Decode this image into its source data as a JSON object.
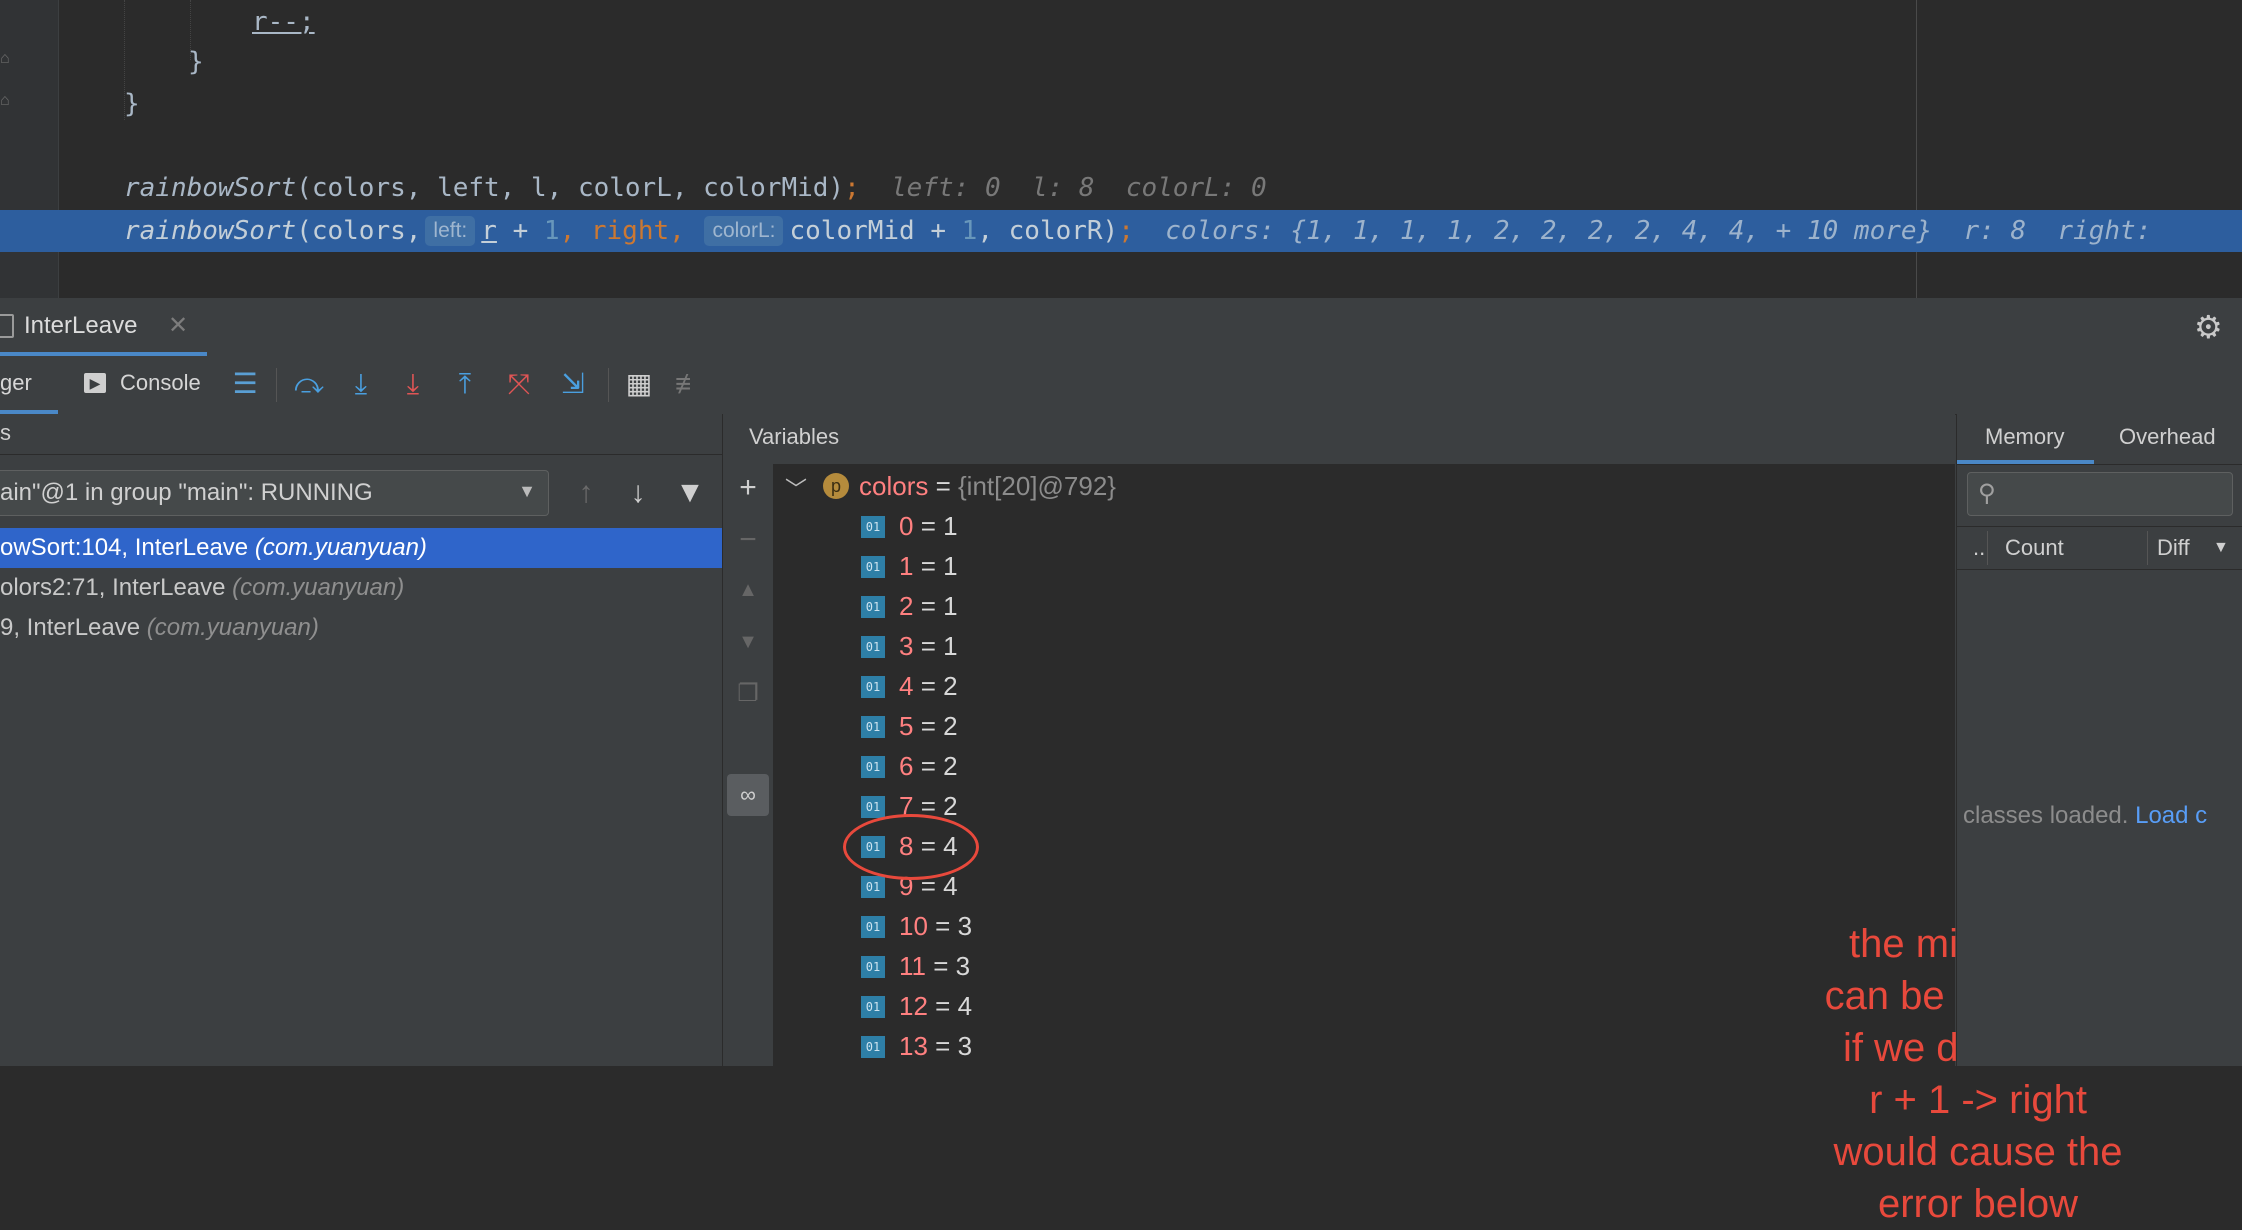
{
  "editor": {
    "lines": {
      "l1": "r--;",
      "l2": "}",
      "l3": "}",
      "l5_fn": "rainbowSort",
      "l5_args": "(colors, left, l, colorL, colorMid)",
      "l5_hint": "left: 0  l: 8  colorL: 0",
      "l6_fn": "rainbowSort",
      "l6_a": "(colors,",
      "l6_inlay1": "left:",
      "l6_b": "r",
      "l6_c": " + ",
      "l6_d": "1",
      "l6_e": ", right, ",
      "l6_inlay2": "colorL:",
      "l6_f": "colorMid + ",
      "l6_g": "1",
      "l6_h": ", colorR)",
      "l6_semi": ";",
      "l6_hint": "colors: {1, 1, 1, 1, 2, 2, 2, 2, 4, 4, + 10 more}  r: 8  right:"
    }
  },
  "debug_window": {
    "tab_title": "InterLeave",
    "tabs": {
      "debugger": "ger",
      "console": "Console"
    }
  },
  "frames": {
    "thread": "ain\"@1 in group \"main\": RUNNING",
    "items": [
      {
        "loc": "owSort:104, InterLeave",
        "pkg": "(com.yuanyuan)"
      },
      {
        "loc": "olors2:71, InterLeave",
        "pkg": "(com.yuanyuan)"
      },
      {
        "loc": "9, InterLeave",
        "pkg": "(com.yuanyuan)"
      }
    ]
  },
  "variables": {
    "title": "Variables",
    "root": {
      "badge": "p",
      "name": "colors",
      "eq": " = ",
      "type": "{int[20]@792}"
    },
    "items": [
      {
        "name": "0",
        "value": "1"
      },
      {
        "name": "1",
        "value": "1"
      },
      {
        "name": "2",
        "value": "1"
      },
      {
        "name": "3",
        "value": "1"
      },
      {
        "name": "4",
        "value": "2"
      },
      {
        "name": "5",
        "value": "2"
      },
      {
        "name": "6",
        "value": "2"
      },
      {
        "name": "7",
        "value": "2"
      },
      {
        "name": "8",
        "value": "4"
      },
      {
        "name": "9",
        "value": "4"
      },
      {
        "name": "10",
        "value": "3"
      },
      {
        "name": "11",
        "value": "3"
      },
      {
        "name": "12",
        "value": "4"
      },
      {
        "name": "13",
        "value": "3"
      }
    ],
    "int_badge": "01"
  },
  "annotation": {
    "lines": [
      "the middle two",
      "can be the same.",
      "if we do left -> l",
      "r + 1 -> right",
      "would cause the",
      "error below"
    ],
    "color": "#e8493c"
  },
  "memory": {
    "tabs": {
      "memory": "Memory",
      "overhead": "Overhead"
    },
    "columns": {
      "dots": "..",
      "count": "Count",
      "diff": "Diff"
    },
    "status_text": "classes loaded. ",
    "status_link": "Load c"
  },
  "colors": {
    "highlight": "#2d5e9e",
    "selected_frame": "#2f65ca",
    "accent": "#4a88c7"
  },
  "icons": [
    "fold-icon",
    "close-icon",
    "gear-icon",
    "console-icon",
    "layout-icon",
    "step-over-icon",
    "step-into-icon",
    "force-step-into-icon",
    "step-out-icon",
    "drop-frame-icon",
    "run-to-cursor-icon",
    "evaluate-icon",
    "trace-icon",
    "arrow-up-icon",
    "arrow-down-icon",
    "filter-icon",
    "plus-icon",
    "minus-icon",
    "move-up-icon",
    "move-down-icon",
    "copy-icon",
    "glasses-icon",
    "search-icon"
  ]
}
